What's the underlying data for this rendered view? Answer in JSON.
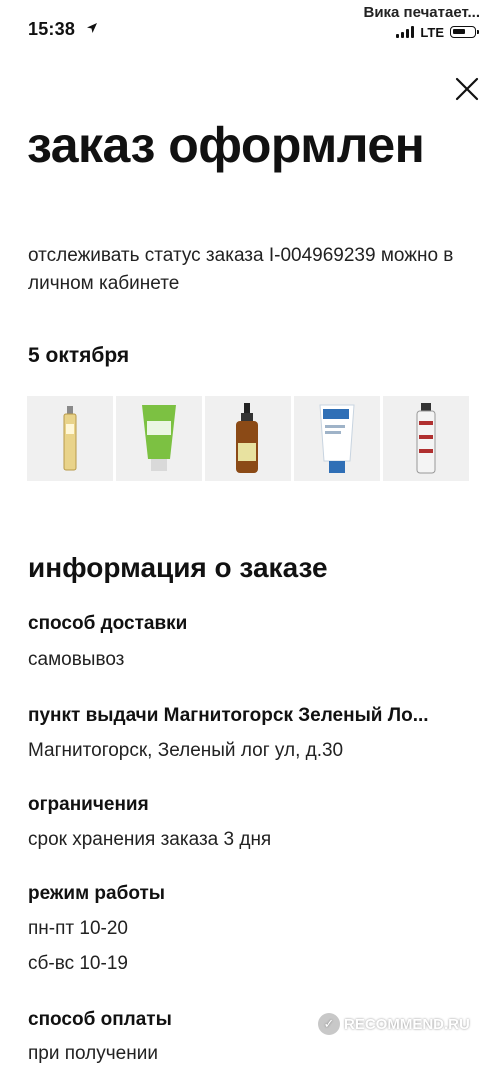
{
  "status_bar": {
    "time": "15:38",
    "carrier": "Вика печатает...",
    "network": "LTE"
  },
  "header": {
    "title": "заказ оформлен",
    "subtitle": "отслеживать статус заказа I-004969239 можно в личном кабинете"
  },
  "order": {
    "date": "5 октября",
    "items": [
      {
        "icon": "perfume-bottle-icon"
      },
      {
        "icon": "green-tube-icon"
      },
      {
        "icon": "spray-bottle-icon"
      },
      {
        "icon": "cream-tube-icon"
      },
      {
        "icon": "spray-can-icon"
      }
    ]
  },
  "info": {
    "title": "информация о заказе",
    "delivery_label": "способ доставки",
    "delivery_value": "самовывоз",
    "pickup_label": "пункт выдачи Магнитогорск Зеленый Ло...",
    "pickup_value": "Магнитогорск, Зеленый лог ул, д.30",
    "limits_label": "ограничения",
    "limits_value": "срок хранения заказа 3 дня",
    "hours_label": "режим работы",
    "hours_weekdays": "пн-пт 10-20",
    "hours_weekend": "сб-вс 10-19",
    "payment_label": "способ оплаты",
    "payment_value": "при получении"
  },
  "watermark": {
    "text": "RECOMMEND.RU"
  },
  "colors": {
    "background": "#ffffff",
    "text": "#111111",
    "thumb_bg": "#f0f0f0"
  }
}
